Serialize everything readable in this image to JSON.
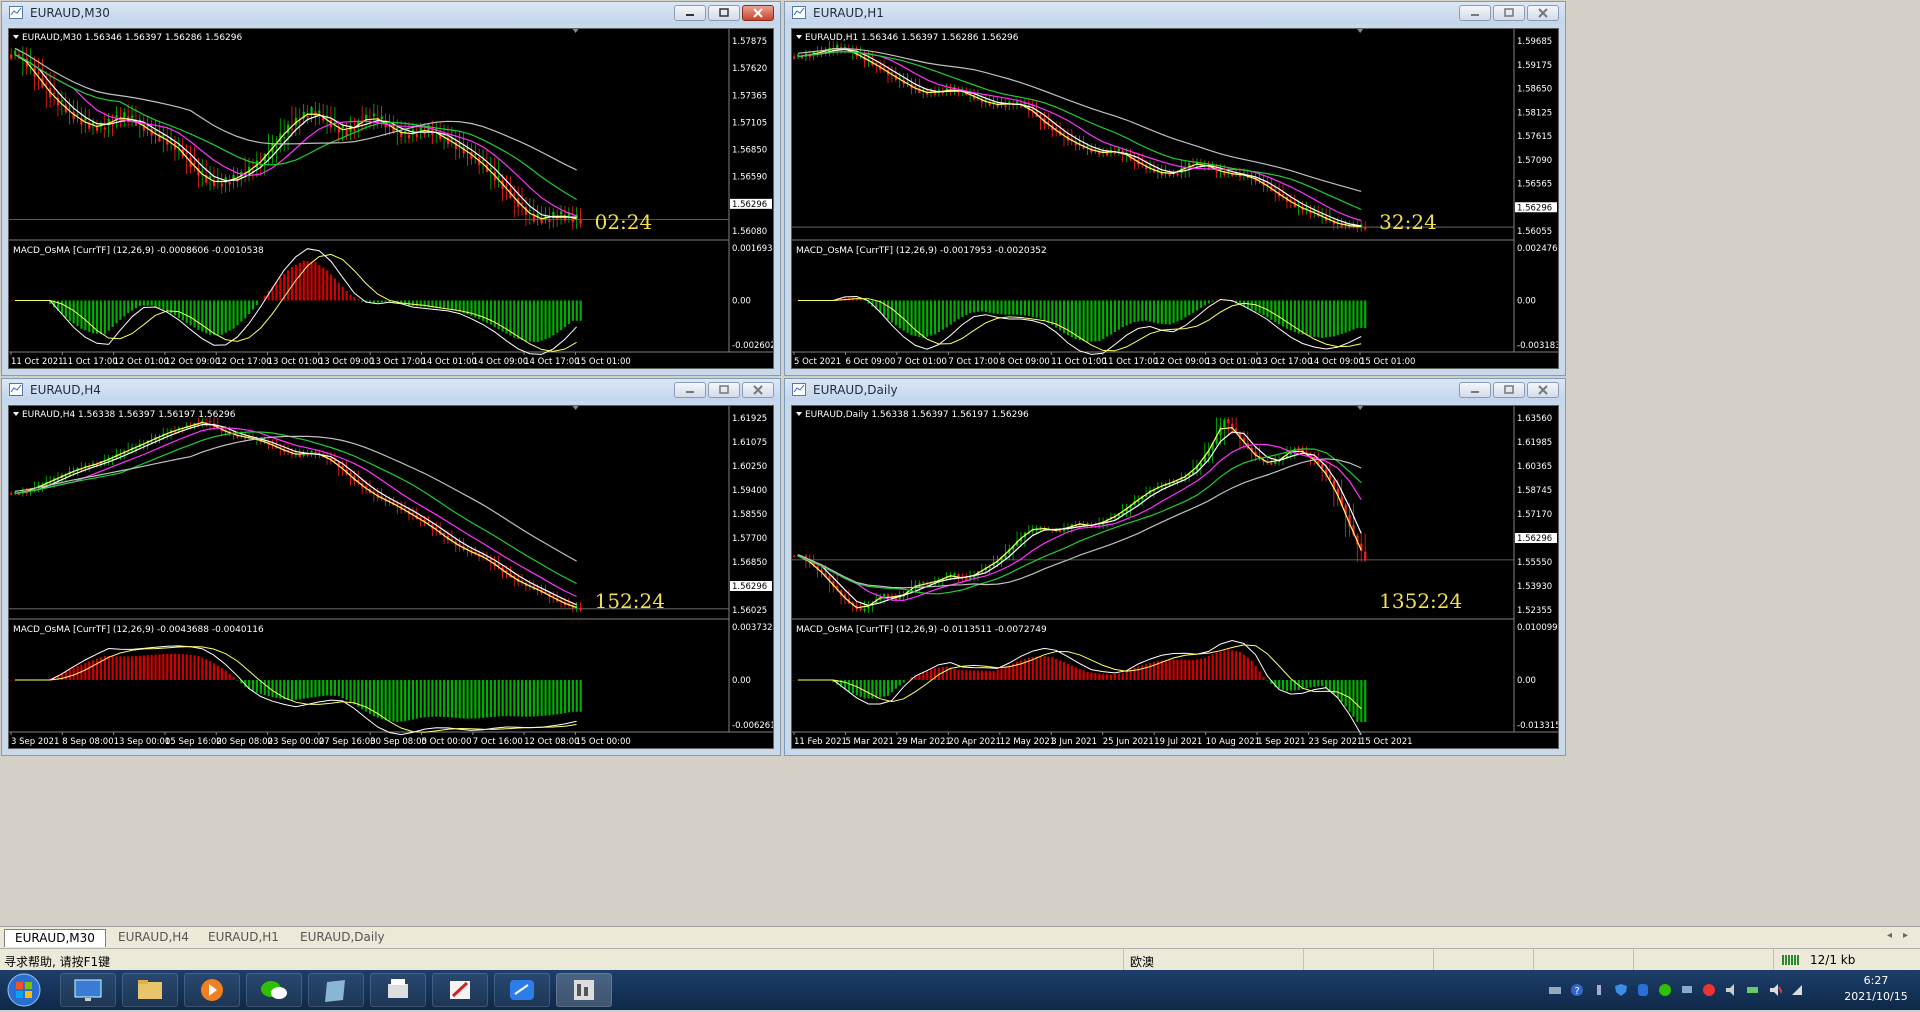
{
  "windows": [
    {
      "id": "m30",
      "title": "EURAUD,M30",
      "info": "EURAUD,M30  1.56346 1.56397 1.56286 1.56296",
      "macd": "MACD_OsMA [CurrTF] (12,26,9) -0.0008606 -0.0010538",
      "timer": "02:24",
      "prices": [
        "1.57875",
        "1.57620",
        "1.57365",
        "1.57105",
        "1.56850",
        "1.56590",
        "1.56296",
        "1.56080"
      ],
      "macd_scale": [
        "0.0016934",
        "0.00",
        "-0.0026025"
      ],
      "xlabels": [
        "11 Oct 2021",
        "11 Oct 17:00",
        "12 Oct 01:00",
        "12 Oct 09:00",
        "12 Oct 17:00",
        "13 Oct 01:00",
        "13 Oct 09:00",
        "13 Oct 17:00",
        "14 Oct 01:00",
        "14 Oct 09:00",
        "14 Oct 17:00",
        "15 Oct 01:00"
      ],
      "series": [
        1.579,
        1.5778,
        1.5762,
        1.5748,
        1.5738,
        1.5728,
        1.5722,
        1.5719,
        1.5726,
        1.573,
        1.5725,
        1.5718,
        1.571,
        1.5705,
        1.5695,
        1.568,
        1.567,
        1.5665,
        1.5668,
        1.5672,
        1.568,
        1.569,
        1.5705,
        1.5718,
        1.5728,
        1.5735,
        1.573,
        1.572,
        1.5715,
        1.5722,
        1.573,
        1.5726,
        1.5718,
        1.5712,
        1.5714,
        1.5718,
        1.5712,
        1.5705,
        1.5698,
        1.569,
        1.568,
        1.5668,
        1.5655,
        1.5642,
        1.5632,
        1.563,
        1.5635,
        1.5632,
        1.563
      ]
    },
    {
      "id": "h1",
      "title": "EURAUD,H1",
      "info": "EURAUD,H1  1.56346 1.56397 1.56286 1.56296",
      "macd": "MACD_OsMA [CurrTF] (12,26,9) -0.0017953 -0.0020352",
      "timer": "32:24",
      "prices": [
        "1.59685",
        "1.59175",
        "1.58650",
        "1.58125",
        "1.57615",
        "1.57090",
        "1.56565",
        "1.56296",
        "1.56055"
      ],
      "macd_scale": [
        "0.0024762",
        "0.00",
        "-0.0031831"
      ],
      "xlabels": [
        "5 Oct 2021",
        "6 Oct 09:00",
        "7 Oct 01:00",
        "7 Oct 17:00",
        "8 Oct 09:00",
        "11 Oct 01:00",
        "11 Oct 17:00",
        "12 Oct 09:00",
        "13 Oct 01:00",
        "13 Oct 17:00",
        "14 Oct 09:00",
        "15 Oct 01:00"
      ],
      "series": [
        1.595,
        1.5955,
        1.596,
        1.5968,
        1.5962,
        1.595,
        1.5938,
        1.5925,
        1.591,
        1.5898,
        1.5885,
        1.588,
        1.5885,
        1.5888,
        1.5882,
        1.587,
        1.5862,
        1.5858,
        1.5862,
        1.5858,
        1.584,
        1.582,
        1.5805,
        1.579,
        1.578,
        1.577,
        1.5768,
        1.5772,
        1.576,
        1.5745,
        1.5735,
        1.5728,
        1.573,
        1.5745,
        1.5748,
        1.574,
        1.573,
        1.5728,
        1.5725,
        1.5715,
        1.57,
        1.5685,
        1.567,
        1.566,
        1.5652,
        1.564,
        1.5632,
        1.563,
        1.5628
      ]
    },
    {
      "id": "h4",
      "title": "EURAUD,H4",
      "info": "EURAUD,H4  1.56338 1.56397 1.56197 1.56296",
      "macd": "MACD_OsMA [CurrTF] (12,26,9) -0.0043688 -0.0040116",
      "timer": "152:24",
      "prices": [
        "1.61925",
        "1.61075",
        "1.60250",
        "1.59400",
        "1.58550",
        "1.57700",
        "1.56850",
        "1.56296",
        "1.56025"
      ],
      "macd_scale": [
        "0.0037321",
        "0.00",
        "-0.0062615"
      ],
      "xlabels": [
        "3 Sep 2021",
        "8 Sep 08:00",
        "13 Sep 00:00",
        "15 Sep 16:00",
        "20 Sep 08:00",
        "23 Sep 00:00",
        "27 Sep 16:00",
        "30 Sep 08:00",
        "5 Oct 00:00",
        "7 Oct 16:00",
        "12 Oct 08:00",
        "15 Oct 00:00"
      ],
      "series": [
        1.596,
        1.597,
        1.5985,
        1.6,
        1.6015,
        1.603,
        1.604,
        1.605,
        1.6065,
        1.608,
        1.6095,
        1.611,
        1.6125,
        1.614,
        1.615,
        1.616,
        1.617,
        1.615,
        1.6135,
        1.6125,
        1.612,
        1.611,
        1.6095,
        1.608,
        1.607,
        1.608,
        1.607,
        1.605,
        1.602,
        1.599,
        1.5965,
        1.5945,
        1.593,
        1.591,
        1.589,
        1.587,
        1.5845,
        1.582,
        1.58,
        1.5785,
        1.577,
        1.5745,
        1.572,
        1.57,
        1.5685,
        1.567,
        1.565,
        1.5635,
        1.5625
      ]
    },
    {
      "id": "daily",
      "title": "EURAUD,Daily",
      "info": "EURAUD,Daily  1.56338 1.56397 1.56197 1.56296",
      "macd": "MACD_OsMA [CurrTF] (12,26,9) -0.0113511 -0.0072749",
      "timer": "1352:24",
      "prices": [
        "1.63560",
        "1.61985",
        "1.60365",
        "1.58745",
        "1.57170",
        "1.56296",
        "1.55550",
        "1.53930",
        "1.52355"
      ],
      "macd_scale": [
        "0.0100998",
        "0.00",
        "-0.0133151"
      ],
      "xlabels": [
        "11 Feb 2021",
        "5 Mar 2021",
        "29 Mar 2021",
        "20 Apr 2021",
        "12 May 2021",
        "3 Jun 2021",
        "25 Jun 2021",
        "19 Jul 2021",
        "10 Aug 2021",
        "1 Sep 2021",
        "23 Sep 2021",
        "15 Oct 2021"
      ],
      "series": [
        1.565,
        1.56,
        1.555,
        1.548,
        1.542,
        1.538,
        1.542,
        1.546,
        1.544,
        1.547,
        1.552,
        1.551,
        1.554,
        1.556,
        1.553,
        1.557,
        1.56,
        1.564,
        1.57,
        1.576,
        1.579,
        1.578,
        1.577,
        1.58,
        1.581,
        1.579,
        1.583,
        1.585,
        1.59,
        1.594,
        1.598,
        1.6,
        1.602,
        1.605,
        1.611,
        1.62,
        1.632,
        1.625,
        1.618,
        1.612,
        1.61,
        1.613,
        1.618,
        1.615,
        1.61,
        1.602,
        1.59,
        1.575,
        1.563
      ]
    }
  ],
  "tabs": [
    "EURAUD,M30",
    "EURAUD,H4",
    "EURAUD,H1",
    "EURAUD,Daily"
  ],
  "status": {
    "help": "寻求帮助, 请按F1键",
    "profile": "欧澳",
    "traffic": "12/1 kb"
  },
  "clock": {
    "time": "6:27",
    "date": "2021/10/15"
  },
  "colors": {
    "bull": "#00c000",
    "bear": "#ff2020",
    "fast": "#ffff66",
    "mid": "#ffffff",
    "magenta": "#ff33ff",
    "green": "#22cc33",
    "gray": "#c0c0c0",
    "macd_up": "#d00000",
    "macd_dn": "#00b000",
    "timer": "#f2e050"
  },
  "taskbar_apps": [
    "start-orb",
    "desktop",
    "explorer",
    "media",
    "wechat",
    "notes",
    "printer",
    "paint",
    "mail",
    "metatrader"
  ]
}
